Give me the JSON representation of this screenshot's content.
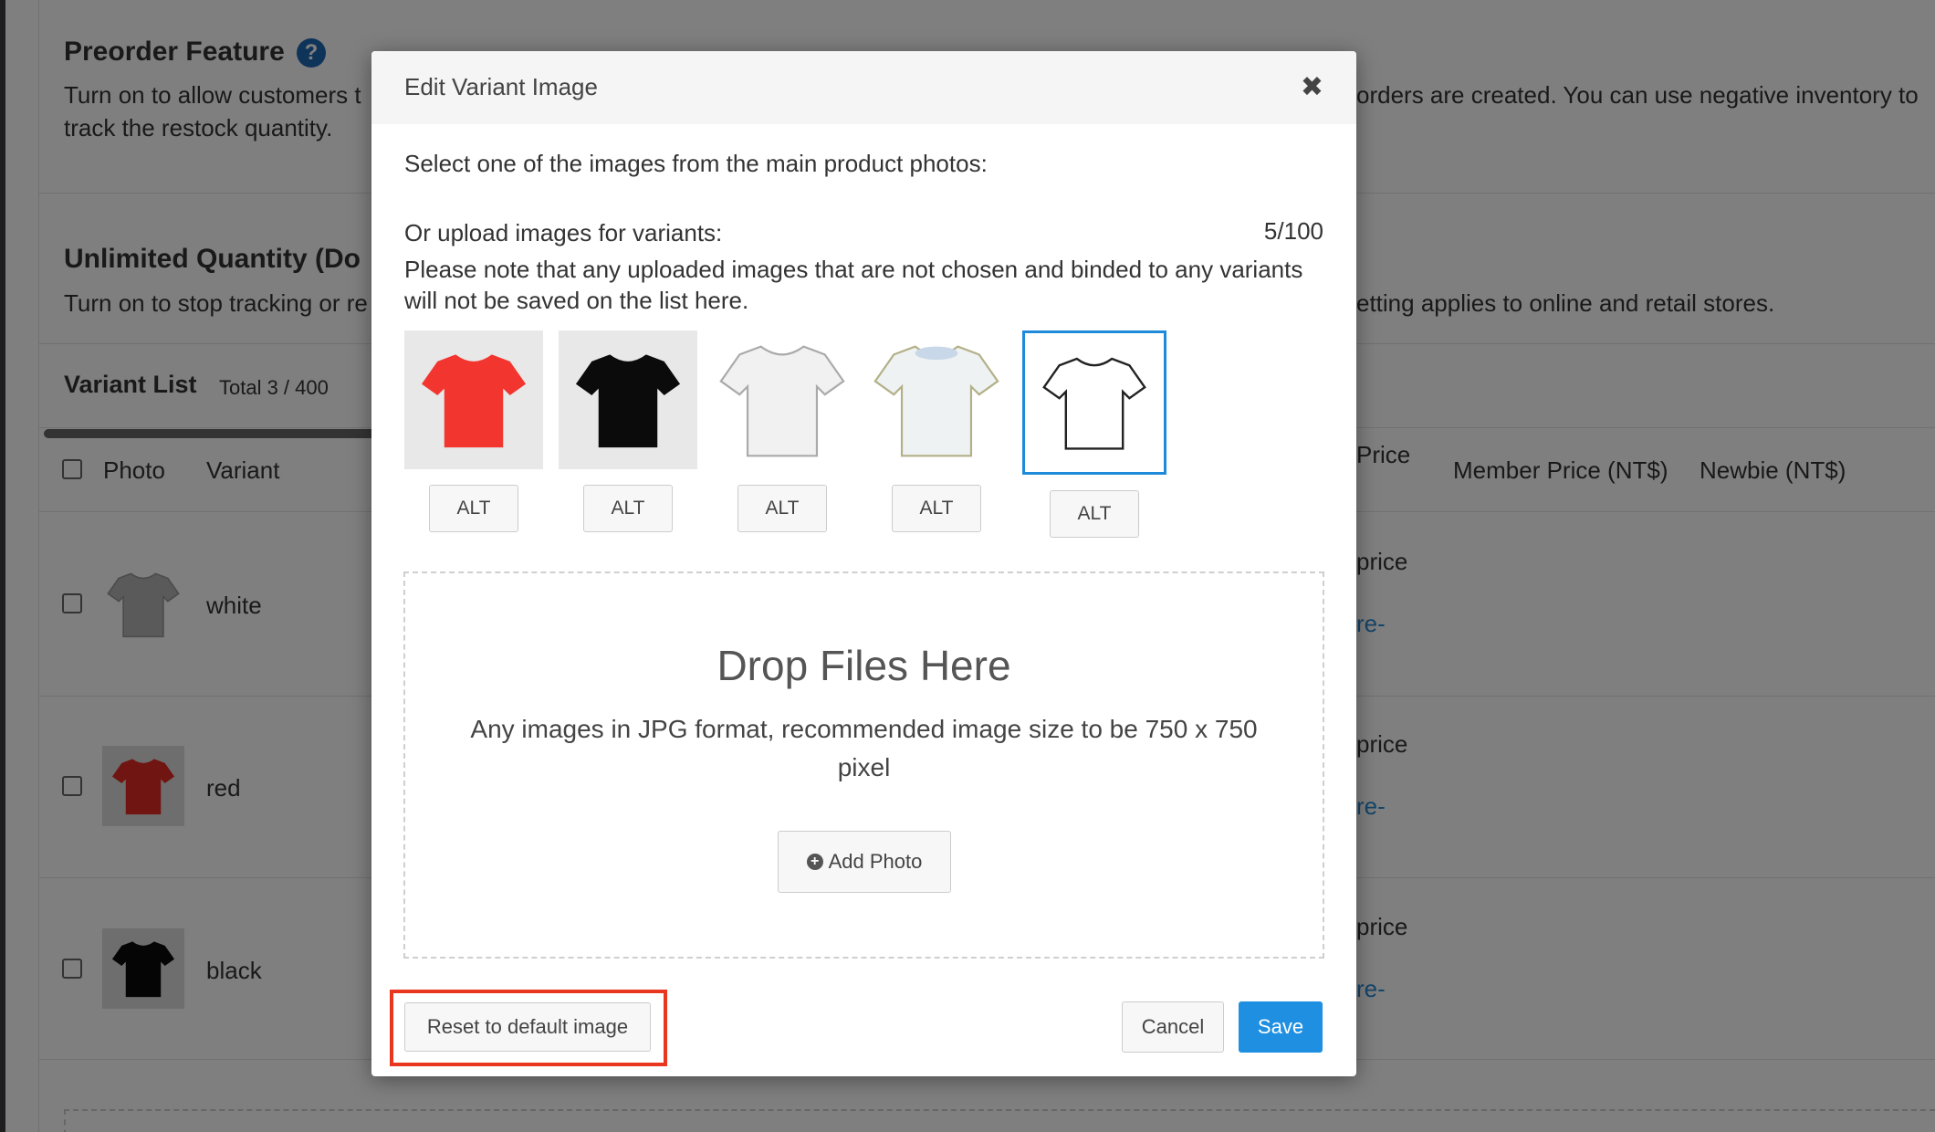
{
  "background": {
    "preorder": {
      "title": "Preorder Feature",
      "help_icon": "?",
      "desc_left_1": "Turn on to allow customers t",
      "desc_left_2": "track the restock quantity.",
      "desc_right_1": "orders are created. You can use negative inventory to"
    },
    "unlimited": {
      "title": "Unlimited Quantity (Do",
      "desc_left": "Turn on to stop tracking or re",
      "desc_right": "etting applies to online and retail stores."
    },
    "variant_list": {
      "title": "Variant List",
      "total": "Total 3 / 400"
    },
    "columns": {
      "photo": "Photo",
      "variant": "Variant",
      "price_fragment": "Price",
      "member_price": "Member Price (NT$)",
      "newbie": "Newbie (NT$)"
    },
    "rows": [
      {
        "variant": "white",
        "price_fragment": "price",
        "link_fragment": "re-"
      },
      {
        "variant": "red",
        "price_fragment": "price",
        "link_fragment": "re-"
      },
      {
        "variant": "black",
        "price_fragment": "price",
        "link_fragment": "re-"
      }
    ]
  },
  "modal": {
    "title": "Edit Variant Image",
    "close_icon": "close-icon",
    "select_text": "Select one of the images from the main product photos:",
    "upload_label": "Or upload images for variants:",
    "upload_count": "5/100",
    "note_line1": "Please note that any uploaded images that are not chosen and binded to any variants",
    "note_line2": "will not be saved on the list here.",
    "images": [
      {
        "kind": "red-tshirt",
        "color": "#f2352e",
        "alt_label": "ALT",
        "selected": false
      },
      {
        "kind": "black-tshirt",
        "color": "#0b0b0b",
        "alt_label": "ALT",
        "selected": false
      },
      {
        "kind": "white-tshirt",
        "color": "#f1f1f1",
        "alt_label": "ALT",
        "selected": false
      },
      {
        "kind": "light-tshirt",
        "color": "#eef2f3",
        "alt_label": "ALT",
        "selected": false
      },
      {
        "kind": "outline-tshirt",
        "color": "#ffffff",
        "alt_label": "ALT",
        "selected": true
      }
    ],
    "dropzone": {
      "title": "Drop Files Here",
      "desc": "Any images in JPG format, recommended image size to be 750 x 750 pixel",
      "add_photo_label": "Add Photo"
    },
    "reset_label": "Reset to default image",
    "cancel_label": "Cancel",
    "save_label": "Save",
    "highlight_color": "#e8361f",
    "accent_color": "#1e8fe1"
  }
}
